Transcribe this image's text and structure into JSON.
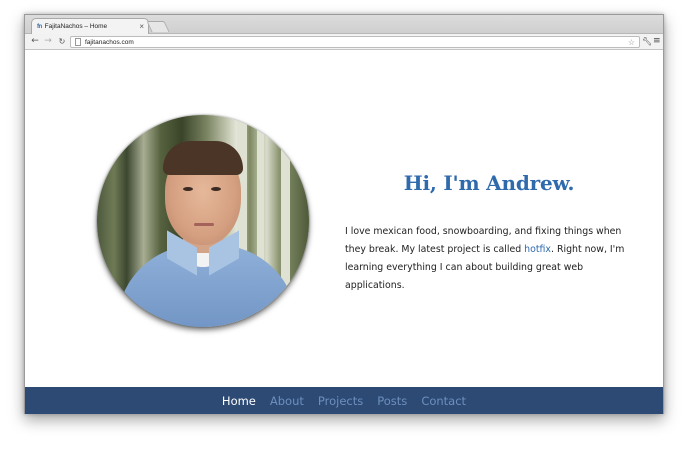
{
  "browser": {
    "tab_title": "FajitaNachos – Home",
    "favicon_text": "fn",
    "tab_close": "×",
    "url": "fajitanachos.com"
  },
  "page": {
    "heading": "Hi, I'm Andrew.",
    "bio_before": "I love mexican food, snowboarding, and fixing things when they break. My latest project is called ",
    "bio_link": "hotfix",
    "bio_after": ". Right now, I'm learning everything I can about building great web applications.",
    "link_color": "#2f6aad"
  },
  "footer": {
    "background": "#2c4a74",
    "nav": [
      {
        "label": "Home",
        "active": true
      },
      {
        "label": "About",
        "active": false
      },
      {
        "label": "Projects",
        "active": false
      },
      {
        "label": "Posts",
        "active": false
      },
      {
        "label": "Contact",
        "active": false
      }
    ]
  },
  "icons": {
    "back": "back-arrow-icon",
    "forward": "forward-arrow-icon",
    "reload": "reload-icon",
    "star": "star-icon",
    "wrench": "wrench-icon",
    "menu": "menu-icon"
  }
}
